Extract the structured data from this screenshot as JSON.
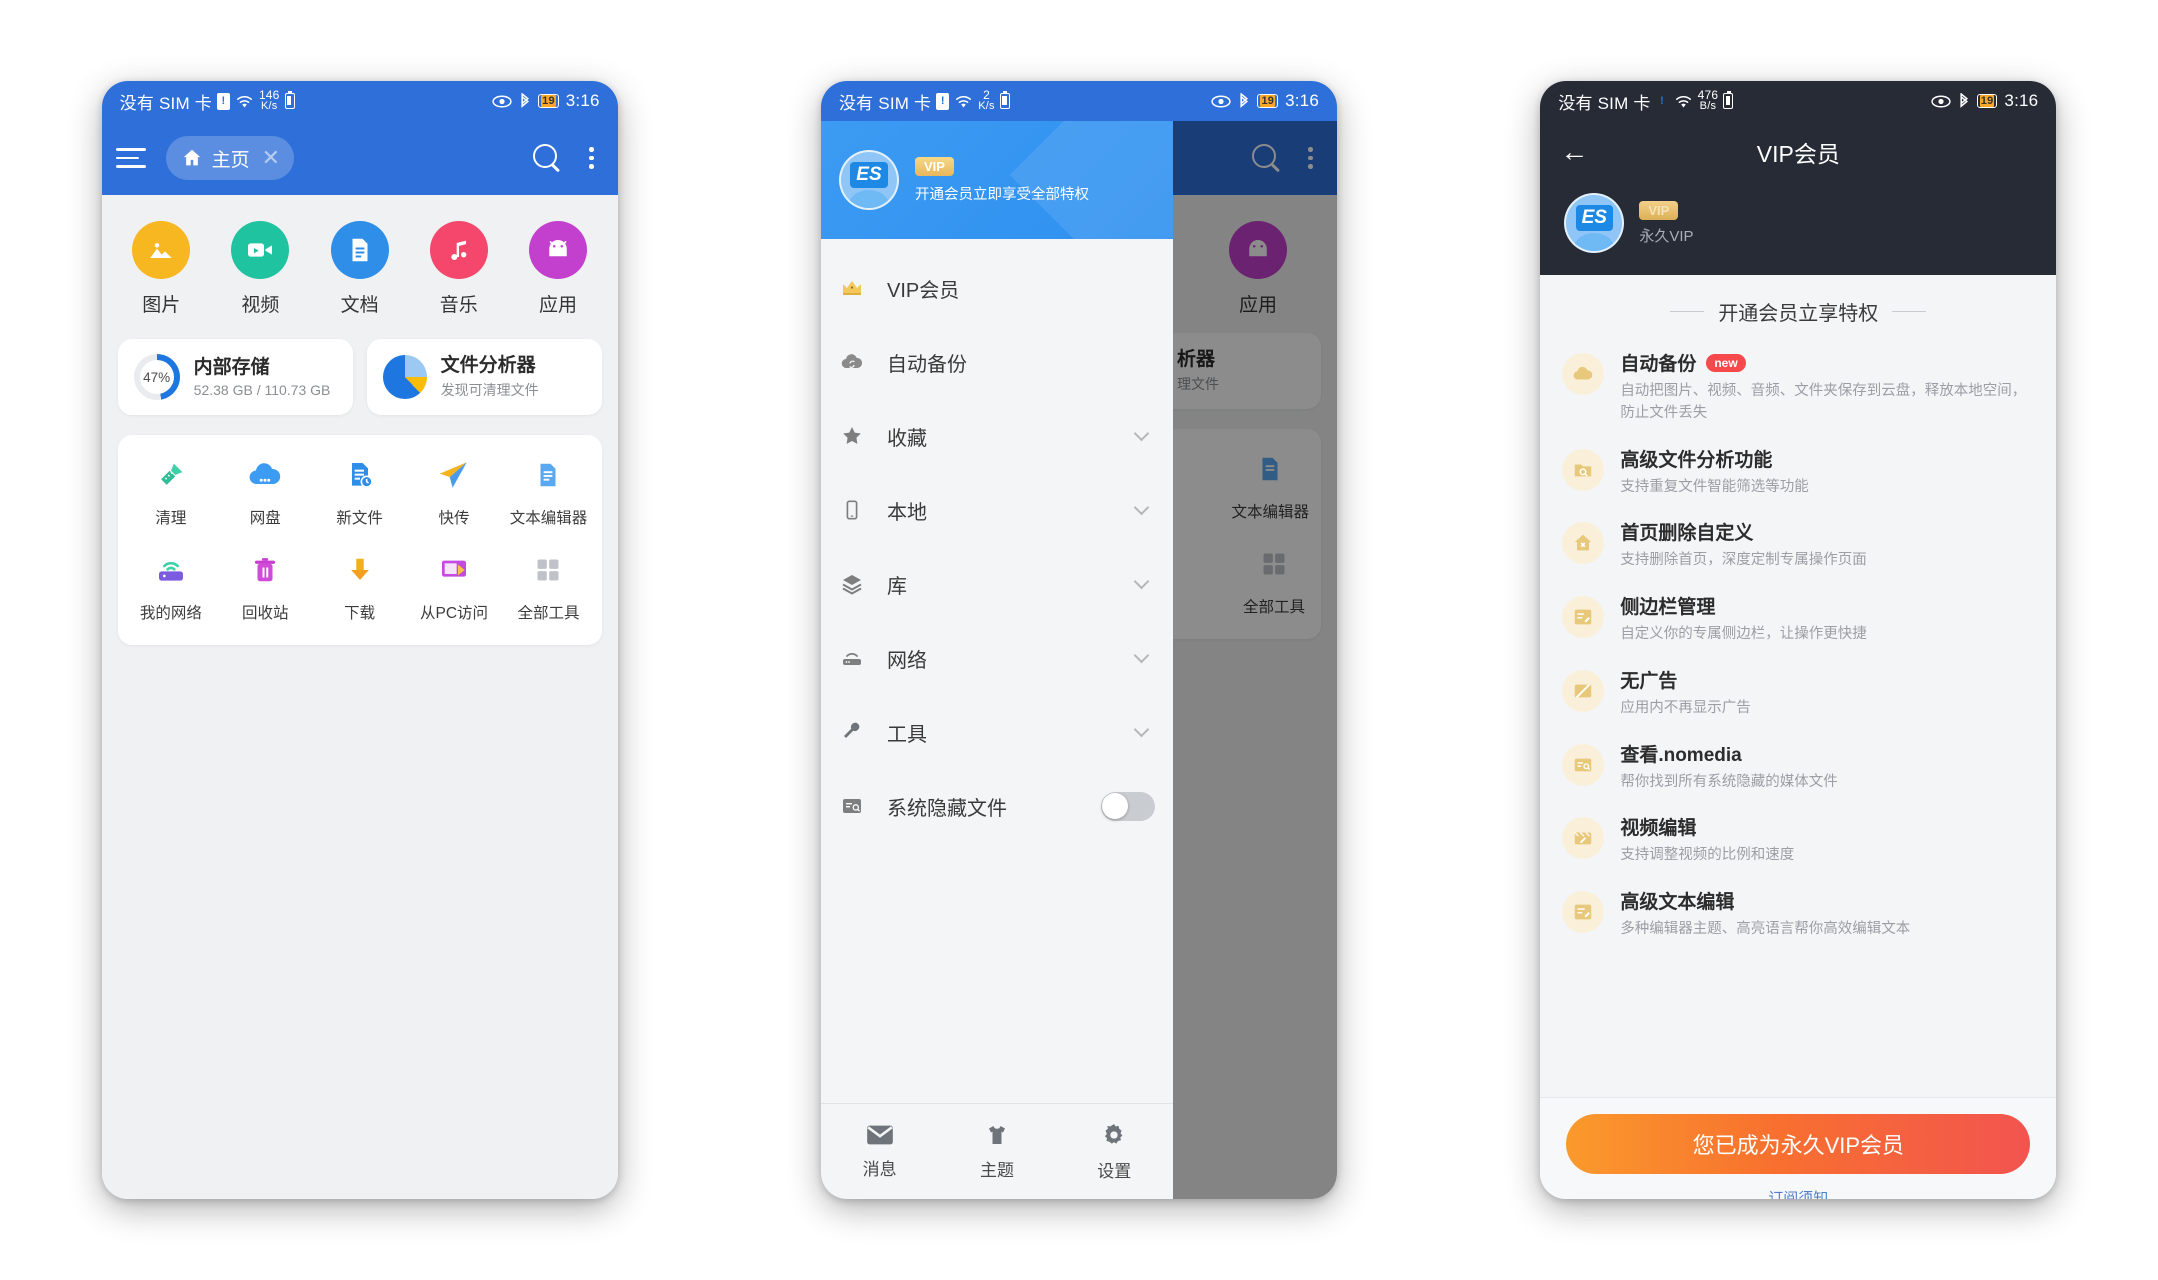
{
  "phone1": {
    "status": {
      "sim": "没有 SIM 卡",
      "rate_num": "146",
      "rate_unit": "K/s",
      "time": "3:16"
    },
    "appbar": {
      "tab_label": "主页",
      "home_icon": "home-icon",
      "menu_icon": "hamburger-icon",
      "search_icon": "search-icon",
      "more_icon": "overflow-menu-icon",
      "close_icon": "close-tab-icon"
    },
    "categories": [
      {
        "label": "图片",
        "icon": "image-icon",
        "color": "#F7B721"
      },
      {
        "label": "视频",
        "icon": "video-icon",
        "color": "#1FC3A0"
      },
      {
        "label": "文档",
        "icon": "document-icon",
        "color": "#2E8EE8"
      },
      {
        "label": "音乐",
        "icon": "music-icon",
        "color": "#F4476B"
      },
      {
        "label": "应用",
        "icon": "android-app-icon",
        "color": "#C33FCE"
      }
    ],
    "storage_card": {
      "title": "内部存储",
      "subtitle": "52.38 GB / 110.73 GB",
      "percent": "47%",
      "percent_value": 47
    },
    "analyzer_card": {
      "title": "文件分析器",
      "subtitle": "发现可清理文件",
      "icon": "pie-chart-icon"
    },
    "tools": [
      {
        "label": "清理",
        "icon": "broom-clean-icon"
      },
      {
        "label": "网盘",
        "icon": "cloud-drive-icon"
      },
      {
        "label": "新文件",
        "icon": "new-file-icon"
      },
      {
        "label": "快传",
        "icon": "send-fast-transfer-icon"
      },
      {
        "label": "文本编辑器",
        "icon": "text-editor-icon"
      },
      {
        "label": "我的网络",
        "icon": "my-network-icon"
      },
      {
        "label": "回收站",
        "icon": "recycle-bin-icon"
      },
      {
        "label": "下载",
        "icon": "download-icon"
      },
      {
        "label": "从PC访问",
        "icon": "pc-access-icon"
      },
      {
        "label": "全部工具",
        "icon": "all-tools-grid-icon"
      }
    ]
  },
  "phone2": {
    "status": {
      "sim": "没有 SIM 卡",
      "rate_num": "2",
      "rate_unit": "K/s",
      "time": "3:16"
    },
    "drawer_header": {
      "badge": "VIP",
      "subtitle": "开通会员立即享受全部特权",
      "avatar": "es-avatar"
    },
    "menu": [
      {
        "label": "VIP会员",
        "icon": "crown-icon",
        "expandable": false
      },
      {
        "label": "自动备份",
        "icon": "cloud-sync-icon",
        "expandable": false
      },
      {
        "label": "收藏",
        "icon": "star-icon",
        "expandable": true
      },
      {
        "label": "本地",
        "icon": "phone-icon",
        "expandable": true
      },
      {
        "label": "库",
        "icon": "layers-icon",
        "expandable": true
      },
      {
        "label": "网络",
        "icon": "router-icon",
        "expandable": true
      },
      {
        "label": "工具",
        "icon": "wrench-icon",
        "expandable": true
      }
    ],
    "hidden_files": {
      "label": "系统隐藏文件",
      "icon": "hidden-file-icon",
      "toggle_on": false
    },
    "bottom_nav": [
      {
        "label": "消息",
        "icon": "envelope-icon"
      },
      {
        "label": "主题",
        "icon": "tshirt-theme-icon"
      },
      {
        "label": "设置",
        "icon": "gear-icon"
      }
    ],
    "behind": {
      "tool_texts": [
        "析器",
        "理文件",
        "文本编辑器",
        "全部工具",
        "应用"
      ]
    }
  },
  "phone3": {
    "status": {
      "sim": "没有 SIM 卡",
      "rate_num": "476",
      "rate_unit": "B/s",
      "time": "3:16"
    },
    "title": "VIP会员",
    "back_icon": "back-arrow-icon",
    "user": {
      "badge": "VIP",
      "name": "永久VIP",
      "avatar": "es-avatar"
    },
    "section_title": "开通会员立享特权",
    "features": [
      {
        "title": "自动备份",
        "badge": "new",
        "desc": "自动把图片、视频、音频、文件夹保存到云盘，释放本地空间，防止文件丢失",
        "icon": "cloud-sync-icon"
      },
      {
        "title": "高级文件分析功能",
        "badge": "",
        "desc": "支持重复文件智能筛选等功能",
        "icon": "folder-search-icon"
      },
      {
        "title": "首页删除自定义",
        "badge": "",
        "desc": "支持删除首页，深度定制专属操作页面",
        "icon": "home-remove-icon"
      },
      {
        "title": "侧边栏管理",
        "badge": "",
        "desc": "自定义你的专属侧边栏，让操作更快捷",
        "icon": "sidebar-edit-icon"
      },
      {
        "title": "无广告",
        "badge": "",
        "desc": "应用内不再显示广告",
        "icon": "no-ads-icon"
      },
      {
        "title": "查看.nomedia",
        "badge": "",
        "desc": "帮你找到所有系统隐藏的媒体文件",
        "icon": "nomedia-search-icon"
      },
      {
        "title": "视频编辑",
        "badge": "",
        "desc": "支持调整视频的比例和速度",
        "icon": "video-edit-icon"
      },
      {
        "title": "高级文本编辑",
        "badge": "",
        "desc": "多种编辑器主题、高亮语言帮你高效编辑文本",
        "icon": "text-edit-icon"
      }
    ],
    "cta_label": "您已成为永久VIP会员",
    "sub_link": "订阅须知"
  },
  "colors": {
    "brand_blue": "#2E6FD9",
    "drawer_blue": "#3C9BF2",
    "dark_bar": "#262B36",
    "cta_from": "#FA9A2C",
    "cta_to": "#F2544F",
    "vip_gold": "#E8B75C"
  }
}
